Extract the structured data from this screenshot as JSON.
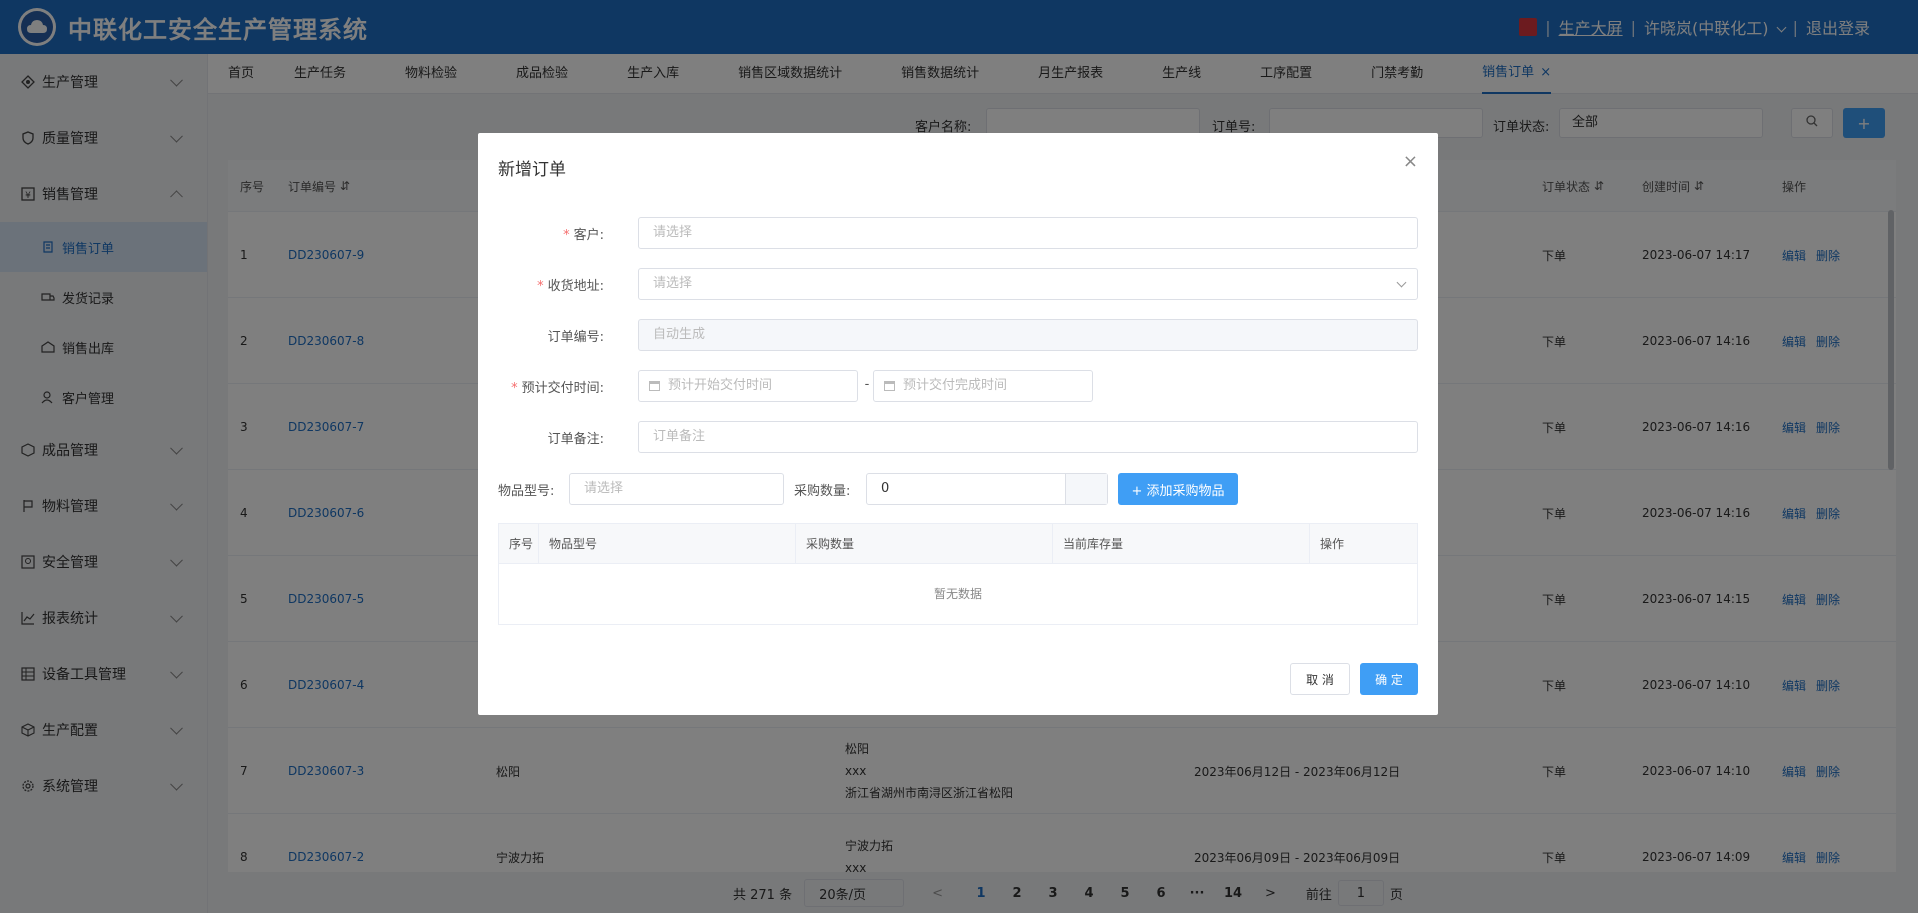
{
  "header": {
    "title": "中联化工安全生产管理系统",
    "screen_link": "生产大屏",
    "user": "许晓岚(中联化工)",
    "logout": "退出登录",
    "sep": "|",
    "bg_color": "#1e6fc5"
  },
  "sidebar": {
    "items": [
      {
        "label": "生产管理",
        "icon": "production-icon"
      },
      {
        "label": "质量管理",
        "icon": "shield-icon"
      },
      {
        "label": "销售管理",
        "icon": "yen-icon"
      },
      {
        "label": "成品管理",
        "icon": "box-icon"
      },
      {
        "label": "物料管理",
        "icon": "material-icon"
      },
      {
        "label": "安全管理",
        "icon": "safety-icon"
      },
      {
        "label": "报表统计",
        "icon": "chart-icon"
      },
      {
        "label": "设备工具管理",
        "icon": "equipment-icon"
      },
      {
        "label": "生产配置",
        "icon": "config-icon"
      },
      {
        "label": "系统管理",
        "icon": "gear-icon"
      }
    ],
    "sub_items": [
      {
        "label": "销售订单"
      },
      {
        "label": "发货记录"
      },
      {
        "label": "销售出库"
      },
      {
        "label": "客户管理"
      }
    ]
  },
  "tabs": [
    "首页",
    "生产任务",
    "物料检验",
    "成品检验",
    "生产入库",
    "销售区域数据统计",
    "销售数据统计",
    "月生产报表",
    "生产线",
    "工序配置",
    "门禁考勤",
    "销售订单"
  ],
  "tab_close": "×",
  "filter": {
    "customer_label": "客户名称:",
    "order_label": "订单号:",
    "status_label": "订单状态:",
    "status_value": "全部",
    "add_symbol": "+"
  },
  "table": {
    "headers": {
      "index": "序号",
      "order_no": "订单编号",
      "status": "订单状态",
      "created": "创建时间",
      "ops": "操作"
    },
    "rows": [
      {
        "index": "1",
        "order_no": "DD230607-9",
        "customer": "",
        "addr": [],
        "delivery": "",
        "status": "下单",
        "created": "2023-06-07 14:17"
      },
      {
        "index": "2",
        "order_no": "DD230607-8",
        "customer": "",
        "addr": [],
        "delivery": "",
        "status": "下单",
        "created": "2023-06-07 14:16"
      },
      {
        "index": "3",
        "order_no": "DD230607-7",
        "customer": "",
        "addr": [],
        "delivery": "",
        "status": "下单",
        "created": "2023-06-07 14:16"
      },
      {
        "index": "4",
        "order_no": "DD230607-6",
        "customer": "",
        "addr": [],
        "delivery": "",
        "status": "下单",
        "created": "2023-06-07 14:16"
      },
      {
        "index": "5",
        "order_no": "DD230607-5",
        "customer": "",
        "addr": [],
        "delivery": "",
        "status": "下单",
        "created": "2023-06-07 14:15"
      },
      {
        "index": "6",
        "order_no": "DD230607-4",
        "customer": "",
        "addr": [],
        "delivery": "",
        "status": "下单",
        "created": "2023-06-07 14:10"
      },
      {
        "index": "7",
        "order_no": "DD230607-3",
        "customer": "松阳",
        "addr": [
          "松阳",
          "xxx",
          "浙江省湖州市南浔区浙江省松阳"
        ],
        "delivery": "2023年06月12日 - 2023年06月12日",
        "status": "下单",
        "created": "2023-06-07 14:10"
      },
      {
        "index": "8",
        "order_no": "DD230607-2",
        "customer": "宁波力拓",
        "addr": [
          "宁波力拓",
          "xxx"
        ],
        "delivery": "2023年06月09日 - 2023年06月09日",
        "status": "下单",
        "created": "2023-06-07 14:09"
      }
    ],
    "op_edit": "编辑",
    "op_delete": "删除"
  },
  "pager": {
    "total": "共 271 条",
    "page_size": "20条/页",
    "prev": "<",
    "pages": [
      "1",
      "2",
      "3",
      "4",
      "5",
      "6"
    ],
    "ellipsis": "···",
    "last": "14",
    "next": ">",
    "goto_label": "前往",
    "goto_value": "1",
    "goto_suffix": "页"
  },
  "modal": {
    "title": "新增订单",
    "close": "×",
    "req_mark": "*",
    "customer_label": "客户:",
    "customer_placeholder": "请选择",
    "address_label": "收货地址:",
    "address_placeholder": "请选择",
    "order_no_label": "订单编号:",
    "order_no_placeholder": "自动生成",
    "delivery_label": "预计交付时间:",
    "delivery_start_placeholder": "预计开始交付时间",
    "delivery_sep": "-",
    "delivery_end_placeholder": "预计交付完成时间",
    "remark_label": "订单备注:",
    "remark_placeholder": "订单备注",
    "model_label": "物品型号:",
    "model_placeholder": "请选择",
    "qty_label": "采购数量:",
    "qty_value": "0",
    "add_item_button": "+ 添加采购物品",
    "items_table_headers": [
      "序号",
      "物品型号",
      "采购数量",
      "当前库存量",
      "操作"
    ],
    "items_empty": "暂无数据",
    "cancel": "取 消",
    "ok": "确 定"
  }
}
